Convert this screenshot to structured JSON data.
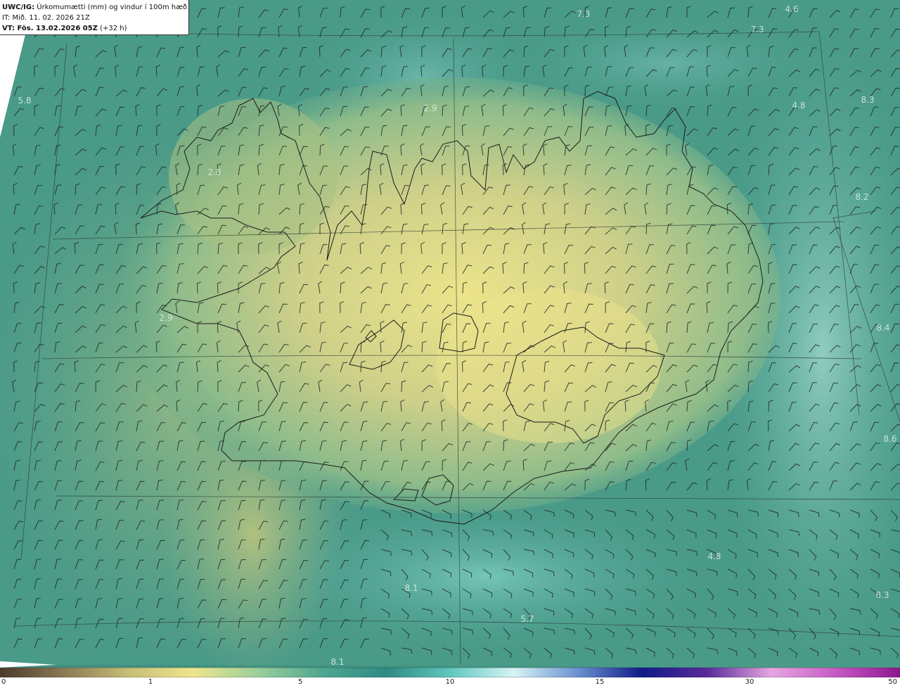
{
  "header": {
    "line1_bold": "UWC/IG:",
    "line1_rest": " Úrkomumætti (mm) og vindur í 100m hæð",
    "line2": "IT: Mið. 11. 02. 2026 21Z",
    "line3_bold": "VT: Fös. 13.02.2026 05Z",
    "line3_rest": " (+32 h)"
  },
  "colorbar": {
    "ticks": [
      "0",
      "1",
      "5",
      "10",
      "15",
      "30",
      "50"
    ],
    "stops": [
      "#4b3a2a",
      "#8a7a55",
      "#c7be76",
      "#eee58e",
      "#9ccf9a",
      "#4fa892",
      "#2f8b83",
      "#5fc7bf",
      "#d6f4f4",
      "#6a8fd0",
      "#101a87",
      "#5a2a9a",
      "#e6a6e2",
      "#c65ac4",
      "#8d168f"
    ]
  },
  "map_labels": [
    {
      "text": "7.3"
    },
    {
      "text": "4.6"
    },
    {
      "text": "7.3"
    },
    {
      "text": "5.8"
    },
    {
      "text": "2.9"
    },
    {
      "text": "4.8"
    },
    {
      "text": "8.3"
    },
    {
      "text": "2.8"
    },
    {
      "text": "8.2"
    },
    {
      "text": "2.9"
    },
    {
      "text": "8.4"
    },
    {
      "text": "8.6"
    },
    {
      "text": "4.8"
    },
    {
      "text": "8.1"
    },
    {
      "text": "5.7"
    },
    {
      "text": "8.3"
    },
    {
      "text": "8.1"
    }
  ]
}
